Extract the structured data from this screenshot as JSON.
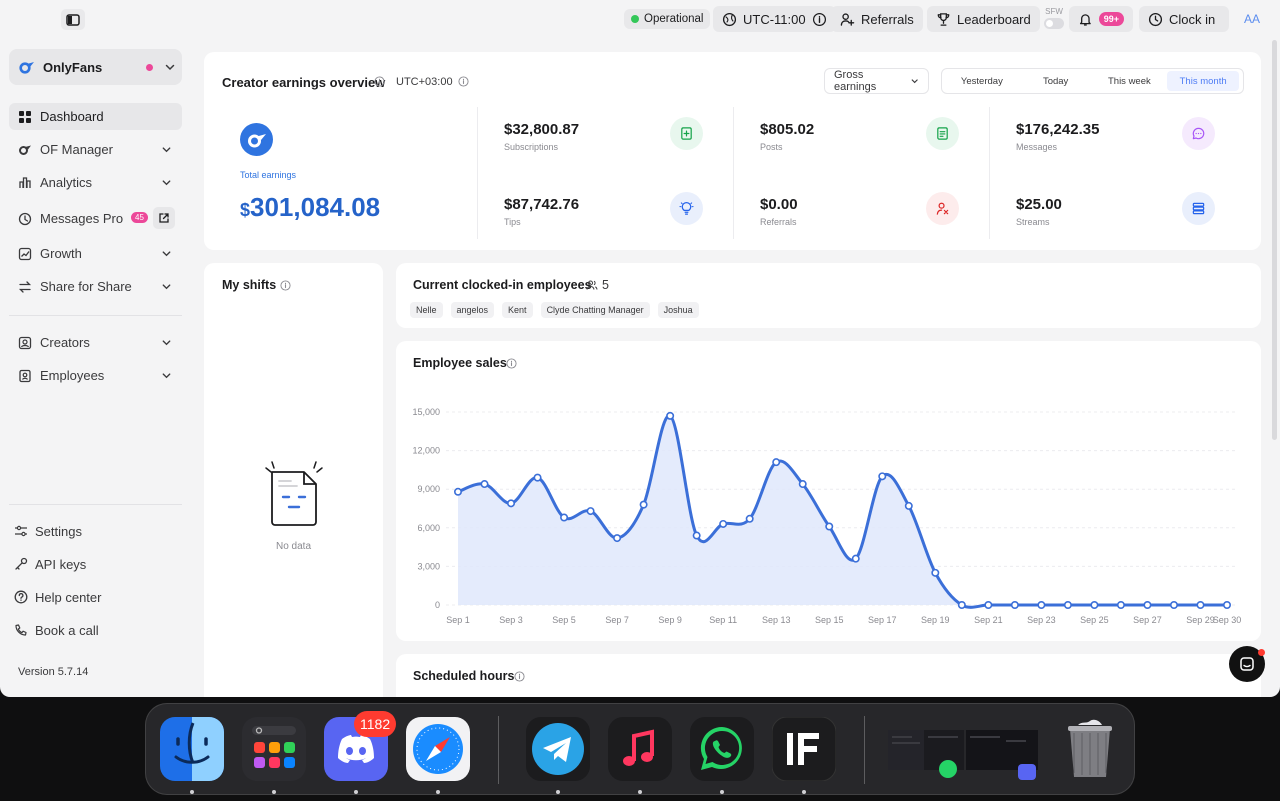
{
  "topbar": {
    "status": "Operational",
    "timezone": "UTC-11:00",
    "referrals": "Referrals",
    "leaderboard": "Leaderboard",
    "sfw": "SFW",
    "notifications_badge": "99+",
    "clock_in": "Clock in",
    "avatar": "AA"
  },
  "sidebar": {
    "creator": "OnlyFans",
    "items": [
      {
        "label": "Dashboard"
      },
      {
        "label": "OF Manager"
      },
      {
        "label": "Analytics"
      },
      {
        "label": "Messages Pro",
        "badge": "45"
      },
      {
        "label": "Growth"
      },
      {
        "label": "Share for Share"
      },
      {
        "label": "Creators"
      },
      {
        "label": "Employees"
      }
    ],
    "footer": [
      {
        "label": "Settings"
      },
      {
        "label": "API keys"
      },
      {
        "label": "Help center"
      },
      {
        "label": "Book a call"
      }
    ],
    "version": "Version 5.7.14"
  },
  "overview": {
    "title": "Creator earnings overview",
    "timezone": "UTC+03:00",
    "earnings_select": "Gross earnings",
    "periods": [
      "Yesterday",
      "Today",
      "This week",
      "This month"
    ],
    "selected_period": "This month",
    "total_label": "Total earnings",
    "total_currency": "$",
    "total_value": "301,084.08",
    "stats": [
      {
        "value": "$32,800.87",
        "label": "Subscriptions",
        "icon": "subscription-icon",
        "color": "#16a34a"
      },
      {
        "value": "$805.02",
        "label": "Posts",
        "icon": "document-icon",
        "color": "#16a34a"
      },
      {
        "value": "$176,242.35",
        "label": "Messages",
        "icon": "message-icon",
        "color": "#a855f7"
      },
      {
        "value": "$87,742.76",
        "label": "Tips",
        "icon": "lightbulb-icon",
        "color": "#2563eb"
      },
      {
        "value": "$0.00",
        "label": "Referrals",
        "icon": "referral-icon",
        "color": "#dc2626"
      },
      {
        "value": "$25.00",
        "label": "Streams",
        "icon": "stream-icon",
        "color": "#2563eb"
      }
    ]
  },
  "shifts": {
    "title": "My shifts",
    "empty": "No data"
  },
  "clocked": {
    "title": "Current clocked-in employees",
    "count": "5",
    "employees": [
      "Nelle",
      "angelos",
      "Kent",
      "Clyde Chatting Manager",
      "Joshua"
    ]
  },
  "sales": {
    "title": "Employee sales"
  },
  "chart_data": {
    "type": "area",
    "title": "Employee sales",
    "x": [
      "Sep 1",
      "Sep 2",
      "Sep 3",
      "Sep 4",
      "Sep 5",
      "Sep 6",
      "Sep 7",
      "Sep 8",
      "Sep 9",
      "Sep 10",
      "Sep 11",
      "Sep 12",
      "Sep 13",
      "Sep 14",
      "Sep 15",
      "Sep 16",
      "Sep 17",
      "Sep 18",
      "Sep 19",
      "Sep 20",
      "Sep 21",
      "Sep 22",
      "Sep 23",
      "Sep 24",
      "Sep 25",
      "Sep 26",
      "Sep 27",
      "Sep 28",
      "Sep 29",
      "Sep 30"
    ],
    "x_tick_labels": [
      "Sep 1",
      "Sep 3",
      "Sep 5",
      "Sep 7",
      "Sep 9",
      "Sep 11",
      "Sep 13",
      "Sep 15",
      "Sep 17",
      "Sep 19",
      "Sep 21",
      "Sep 23",
      "Sep 25",
      "Sep 27",
      "Sep 29",
      "Sep 30"
    ],
    "values": [
      8800,
      9400,
      7900,
      9900,
      6800,
      7300,
      5200,
      7800,
      14700,
      5400,
      6300,
      6700,
      11100,
      9400,
      6100,
      3600,
      10000,
      7700,
      2500,
      0,
      0,
      0,
      0,
      0,
      0,
      0,
      0,
      0,
      0,
      0
    ],
    "y_ticks": [
      "0",
      "3,000",
      "6,000",
      "9,000",
      "12,000",
      "15,000"
    ],
    "ylim": [
      0,
      15000
    ],
    "grid": true,
    "color": "#3b6fd8"
  },
  "scheduled": {
    "title": "Scheduled hours"
  },
  "dock": {
    "discord_badge": "1182",
    "apps": [
      "finder-icon",
      "launchpad-icon",
      "discord-icon",
      "safari-icon",
      "telegram-icon",
      "music-icon",
      "whatsapp-icon",
      "if-app-icon",
      "recent-window-icon",
      "trash-icon"
    ]
  }
}
